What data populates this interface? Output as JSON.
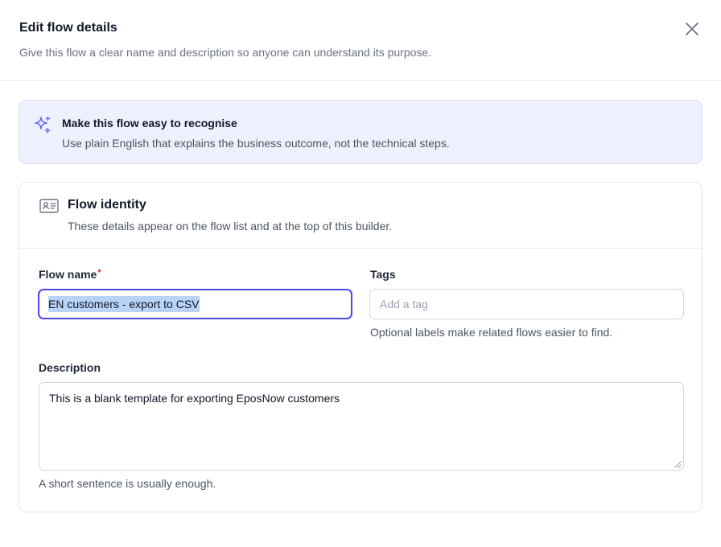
{
  "dialog": {
    "title": "Edit flow details",
    "subtitle": "Give this flow a clear name and description so anyone can understand its purpose.",
    "close_icon": "close-icon"
  },
  "banner": {
    "icon": "sparkles-icon",
    "title": "Make this flow easy to recognise",
    "text": "Use plain English that explains the business outcome, not the technical steps."
  },
  "identity": {
    "icon": "id-card-icon",
    "title": "Flow identity",
    "subtitle": "These details appear on the flow list and at the top of this builder.",
    "flow_name": {
      "label": "Flow name",
      "required_mark": "*",
      "value": "EN customers - export to CSV"
    },
    "tags": {
      "label": "Tags",
      "placeholder": "Add a tag",
      "help": "Optional labels make related flows easier to find."
    },
    "description": {
      "label": "Description",
      "value": "This is a blank template for exporting EposNow customers",
      "help": "A short sentence is usually enough."
    }
  },
  "colors": {
    "accent": "#4f46e5",
    "required": "#dc2626",
    "banner_bg": "#eff0fd",
    "selection": "#b9d3f7"
  }
}
